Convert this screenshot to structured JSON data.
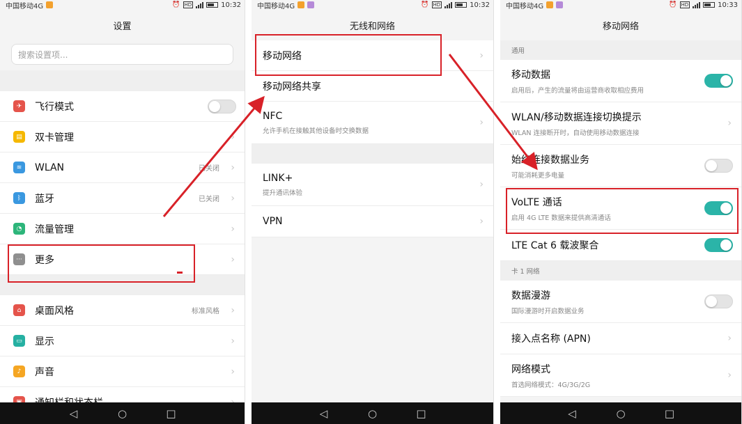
{
  "status_bar": {
    "p1": {
      "carrier": "中国移动4G",
      "time": "10:32",
      "hd": "HD"
    },
    "p2": {
      "carrier": "中国移动4G",
      "time": "10:32",
      "hd": "HD"
    },
    "p3": {
      "carrier": "中国移动4G",
      "time": "10:33",
      "hd": "HD"
    }
  },
  "settings": {
    "title": "设置",
    "search_placeholder": "搜索设置项...",
    "items": [
      {
        "label": "飞行模式",
        "icon": "airplane-icon",
        "color": "#e5544b"
      },
      {
        "label": "双卡管理",
        "icon": "sim-card-icon",
        "color": "#f5b800"
      },
      {
        "label": "WLAN",
        "icon": "wifi-icon",
        "color": "#3a98e0",
        "value": "已关闭"
      },
      {
        "label": "蓝牙",
        "icon": "bluetooth-icon",
        "color": "#3a98e0",
        "value": "已关闭"
      },
      {
        "label": "流量管理",
        "icon": "data-usage-icon",
        "color": "#2db57a"
      },
      {
        "label": "更多",
        "icon": "more-icon",
        "color": "#8f8f8f"
      },
      {
        "label": "桌面风格",
        "icon": "home-icon",
        "color": "#e5544b",
        "value": "标准风格"
      },
      {
        "label": "显示",
        "icon": "display-icon",
        "color": "#26b0a2"
      },
      {
        "label": "声音",
        "icon": "sound-icon",
        "color": "#f5a623"
      },
      {
        "label": "通知栏和状态栏",
        "icon": "notification-icon",
        "color": "#e5544b"
      }
    ]
  },
  "wireless": {
    "title": "无线和网络",
    "items": [
      {
        "label": "移动网络"
      },
      {
        "label": "移动网络共享"
      },
      {
        "label": "NFC",
        "sub": "允许手机在接触其他设备时交换数据"
      },
      {
        "label": "LINK+",
        "sub": "提升通讯体验"
      },
      {
        "label": "VPN"
      }
    ]
  },
  "mobile_network": {
    "title": "移动网络",
    "section_general": "通用",
    "section_card1": "卡 1 网络",
    "items": [
      {
        "label": "移动数据",
        "sub": "启用后，产生的流量将由运营商收取相应费用",
        "toggle": "on"
      },
      {
        "label": "WLAN/移动数据连接切换提示",
        "sub": "WLAN 连接断开时，自动使用移动数据连接"
      },
      {
        "label": "始终连接数据业务",
        "sub": "可能消耗更多电量",
        "toggle": "off"
      },
      {
        "label": "VoLTE 通话",
        "sub": "启用 4G LTE 数据来提供高清通话",
        "toggle": "on"
      },
      {
        "label": "LTE Cat 6 载波聚合",
        "toggle": "on"
      },
      {
        "label": "数据漫游",
        "sub": "国际漫游时开启数据业务",
        "toggle": "off"
      },
      {
        "label": "接入点名称 (APN)"
      },
      {
        "label": "网络模式",
        "sub": "首选网络模式：4G/3G/2G"
      }
    ]
  },
  "nav": {
    "back": "◁",
    "home": "○",
    "recent": "□"
  },
  "annotation_color": "#d82128",
  "toggle_on_color": "#2bb4a8"
}
